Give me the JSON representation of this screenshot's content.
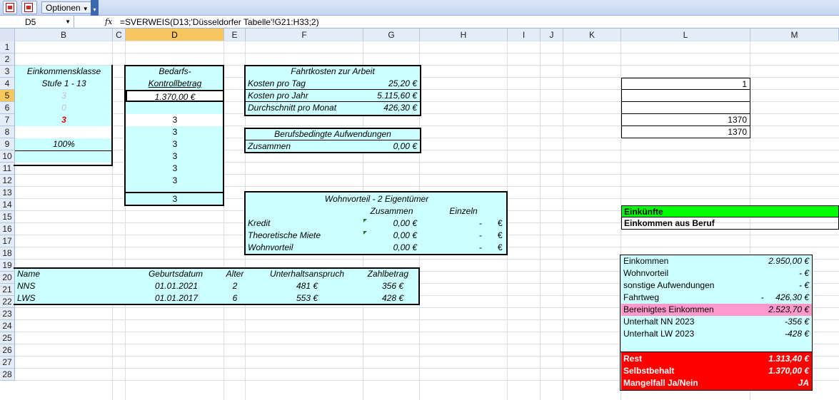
{
  "toolbar": {
    "options_label": "Optionen",
    "overflow_glyph": "▾"
  },
  "formula_bar": {
    "name_box": "D5",
    "fx": "fx",
    "formula": "=SVERWEIS(D13;'Düsseldorfer Tabelle'!G21:H33;2)"
  },
  "columns": [
    "B",
    "C",
    "D",
    "E",
    "F",
    "G",
    "H",
    "I",
    "J",
    "K",
    "L",
    "M"
  ],
  "rows": [
    "1",
    "2",
    "3",
    "4",
    "5",
    "6",
    "7",
    "8",
    "9",
    "10",
    "11",
    "12",
    "13",
    "14",
    "15",
    "16",
    "17",
    "18",
    "19",
    "20",
    "21",
    "22",
    "23",
    "24",
    "25",
    "26",
    "27",
    "28"
  ],
  "einkommensklasse": {
    "title1": "Einkommensklasse",
    "title2": "Stufe 1 - 13",
    "v5": "3",
    "v6": "0",
    "v7": "3",
    "v9": "100%"
  },
  "bedarf": {
    "title1": "Bedarfs-",
    "title2": "Kontrollbetrag",
    "v5": "1.370,00 €",
    "v7": "3",
    "v8": "3",
    "v9": "3",
    "v10": "3",
    "v11": "3",
    "v12": "3",
    "v13": "3"
  },
  "fahrtkosten": {
    "title": "Fahrtkosten zur Arbeit",
    "rows": [
      {
        "label": "Kosten pro Tag",
        "value": "25,20 €"
      },
      {
        "label": "Kosten pro Jahr",
        "value": "5.115,60 €"
      },
      {
        "label": "Durchschnitt pro Monat",
        "value": "426,30 €"
      }
    ]
  },
  "berufsbedingt": {
    "title": "Berufsbedingte Aufwendungen",
    "label": "Zusammen",
    "value": "0,00 €"
  },
  "wohnvorteil": {
    "title": "Wohnvorteil - 2 Eigentümer",
    "col1": "Zusammen",
    "col2": "Einzeln",
    "rows": [
      {
        "label": "Kredit",
        "value": "0,00 €",
        "dash": "-",
        "euro": "€"
      },
      {
        "label": "Theoretische Miete",
        "value": "0,00 €",
        "dash": "-",
        "euro": "€"
      },
      {
        "label": "Wohnvorteil",
        "value": "0,00 €",
        "dash": "-",
        "euro": "€"
      }
    ]
  },
  "kinder": {
    "headers": [
      "Name",
      "Geburtsdatum",
      "Alter",
      "Unterhaltsanspruch",
      "Zahlbetrag"
    ],
    "rows": [
      [
        "NNS",
        "01.01.2021",
        "2",
        "481 €",
        "356 €"
      ],
      [
        "LWS",
        "01.01.2017",
        "6",
        "553 €",
        "428 €"
      ]
    ]
  },
  "col_l": {
    "v4": "1",
    "v7": "1370",
    "v8": "1370"
  },
  "einkuenfte": {
    "title": "Einkünfte",
    "subtitle": "Einkommen aus Beruf"
  },
  "summary": [
    {
      "label": "Einkommen",
      "value": "2.950,00 €"
    },
    {
      "label": "Wohnvorteil",
      "value": "-   €"
    },
    {
      "label": "sonstige Aufwendungen",
      "value": "-   €"
    },
    {
      "label": "Fahrtweg",
      "value": "-     426,30 €"
    },
    {
      "label": "Bereinigtes Einkommen",
      "value": "2.523,70 €"
    },
    {
      "label": "Unterhalt NN 2023",
      "value": "-356 €"
    },
    {
      "label": "Unterhalt LW 2023",
      "value": "-428 €"
    }
  ],
  "result": [
    {
      "label": "Rest",
      "value": "1.313,40 €"
    },
    {
      "label": "Selbstbehalt",
      "value": "1.370,00 €"
    },
    {
      "label": "Mangelfall Ja/Nein",
      "value": "JA"
    }
  ],
  "colors": {
    "cyan": "#ccffff",
    "green": "#00ff00",
    "pink": "#ff99cc",
    "red": "#ff0000",
    "selection": "#f8c65e"
  }
}
